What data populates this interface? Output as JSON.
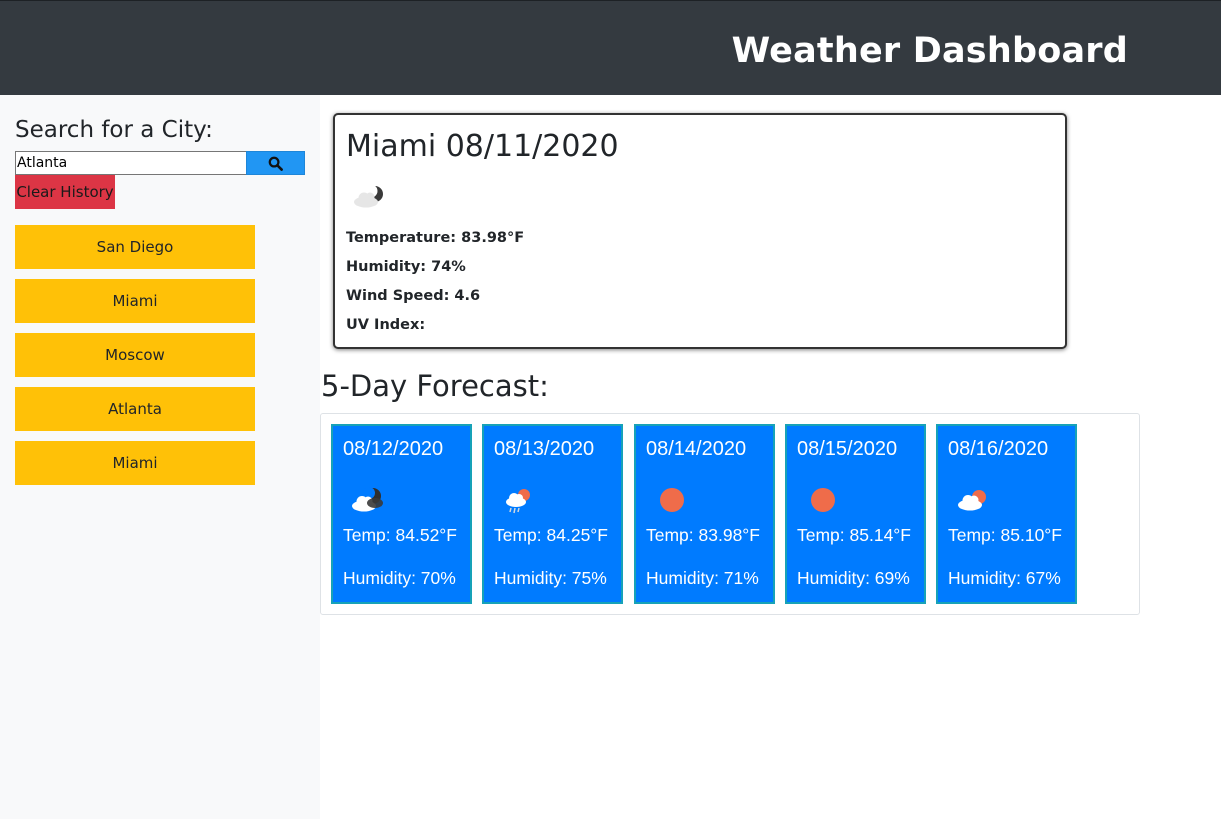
{
  "header": {
    "title": "Weather Dashboard"
  },
  "sidebar": {
    "label": "Search for a City:",
    "search_value": "Atlanta",
    "search_icon": "search-icon",
    "clear_label": "Clear History",
    "cities": [
      "San Diego",
      "Miami",
      "Moscow",
      "Atlanta",
      "Miami"
    ]
  },
  "current": {
    "title": "Miami 08/11/2020",
    "icon": "partly-cloudy-night-icon",
    "temperature": "Temperature: 83.98°F",
    "humidity": "Humidity: 74%",
    "wind": "Wind Speed: 4.6",
    "uv": "UV Index:"
  },
  "forecast": {
    "title": "5-Day Forecast:",
    "days": [
      {
        "date": "08/12/2020",
        "icon": "partly-cloudy-night-icon",
        "temp": "Temp: 84.52°F",
        "humidity": "Humidity: 70%"
      },
      {
        "date": "08/13/2020",
        "icon": "rain-sun-icon",
        "temp": "Temp: 84.25°F",
        "humidity": "Humidity: 75%"
      },
      {
        "date": "08/14/2020",
        "icon": "sun-icon",
        "temp": "Temp: 83.98°F",
        "humidity": "Humidity: 71%"
      },
      {
        "date": "08/15/2020",
        "icon": "sun-icon",
        "temp": "Temp: 85.14°F",
        "humidity": "Humidity: 69%"
      },
      {
        "date": "08/16/2020",
        "icon": "partly-cloudy-day-icon",
        "temp": "Temp: 85.10°F",
        "humidity": "Humidity: 67%"
      }
    ]
  },
  "colors": {
    "header": "#343a40",
    "city_button": "#ffc107",
    "clear_button": "#dc3545",
    "search_button": "#2196f3",
    "forecast_card": "#007bff",
    "card_border": "#17a2b8",
    "sun": "#ef6c4a"
  }
}
